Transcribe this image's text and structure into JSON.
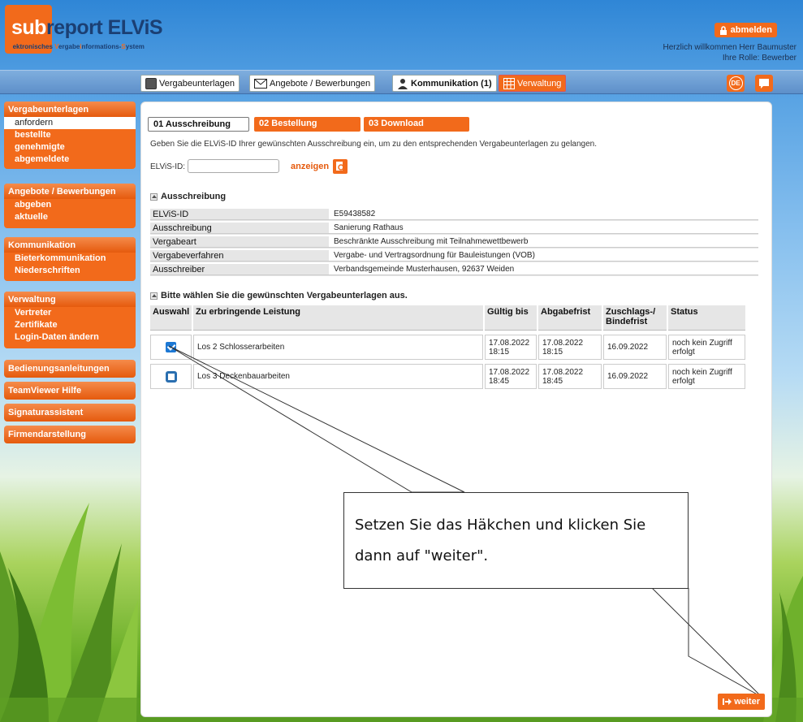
{
  "header": {
    "brand_sub": "sub",
    "brand_rest": "report ELViS",
    "tagline_parts": [
      "El",
      "ektronisches ",
      "V",
      "ergabe",
      "i",
      "nformations-",
      "S",
      "ystem"
    ],
    "logout_label": "abmelden",
    "welcome": "Herzlich willkommen Herr Baumuster",
    "role": "Ihre Rolle: Bewerber"
  },
  "topnav": {
    "items": [
      {
        "label": "Vergabeunterlagen",
        "icon": "documents-icon"
      },
      {
        "label": "Angebote / Bewerbungen",
        "icon": "envelope-icon"
      },
      {
        "label": "Kommunikation (1)",
        "icon": "person-icon"
      },
      {
        "label": "Verwaltung",
        "icon": "calendar-grid-icon"
      }
    ],
    "lang": "DE"
  },
  "sidebar": {
    "sections": [
      {
        "title": "Vergabeunterlagen",
        "items": [
          "anfordern",
          "bestellte",
          "genehmigte",
          "abgemeldete"
        ],
        "active": 0
      },
      {
        "title": "Angebote / Bewerbungen",
        "items": [
          "abgeben",
          "aktuelle"
        ]
      },
      {
        "title": "Kommunikation",
        "items": [
          "Bieterkommunikation",
          "Niederschriften"
        ]
      },
      {
        "title": "Verwaltung",
        "items": [
          "Vertreter",
          "Zertifikate",
          "Login-Daten ändern"
        ]
      },
      {
        "title": "Bedienungsanleitungen"
      },
      {
        "title": "TeamViewer Hilfe"
      },
      {
        "title": "Signaturassistent"
      },
      {
        "title": "Firmendarstellung"
      }
    ]
  },
  "main": {
    "tabs": [
      "01 Ausschreibung",
      "02 Bestellung",
      "03 Download"
    ],
    "intro": "Geben Sie die ELViS-ID Ihrer gewünschten Ausschreibung ein, um zu den entsprechenden Vergabeunterlagen zu gelangen.",
    "id_label": "ELViS-ID:",
    "id_value": "",
    "show_label": "anzeigen",
    "section1_title": "Ausschreibung",
    "info": [
      {
        "key": "ELViS-ID",
        "value": "E59438582"
      },
      {
        "key": "Ausschreibung",
        "value": "Sanierung Rathaus"
      },
      {
        "key": "Vergabeart",
        "value": "Beschränkte Ausschreibung mit Teilnahmewettbewerb"
      },
      {
        "key": "Vergabeverfahren",
        "value": "Vergabe- und Vertragsordnung für Bauleistungen (VOB)"
      },
      {
        "key": "Ausschreiber",
        "value": "Verbandsgemeinde Musterhausen, 92637 Weiden"
      }
    ],
    "section2_title": "Bitte wählen Sie die gewünschten Vergabeunterlagen aus.",
    "columns": [
      "Auswahl",
      "Zu erbringende Leistung",
      "Gültig bis",
      "Abgabefrist",
      "Zuschlags-/ Bindefrist",
      "Status"
    ],
    "rows": [
      {
        "checked": true,
        "leistung": "Los 2 Schlosserarbeiten",
        "gueltig": "17.08.2022 18:15",
        "abgabe": "17.08.2022 18:15",
        "zuschlag": "16.09.2022",
        "status": "noch kein Zugriff erfolgt"
      },
      {
        "checked": false,
        "leistung": "Los 3 Deckenbauarbeiten",
        "gueltig": "17.08.2022 18:45",
        "abgabe": "17.08.2022 18:45",
        "zuschlag": "16.09.2022",
        "status": "noch kein Zugriff erfolgt"
      }
    ],
    "callout": "Setzen Sie das Häkchen und klicken Sie dann auf \"weiter\".",
    "next_label": "weiter"
  },
  "colors": {
    "accent": "#f26a1b",
    "brand_blue": "#1b3f73",
    "checkbox_blue": "#1d78d4"
  }
}
